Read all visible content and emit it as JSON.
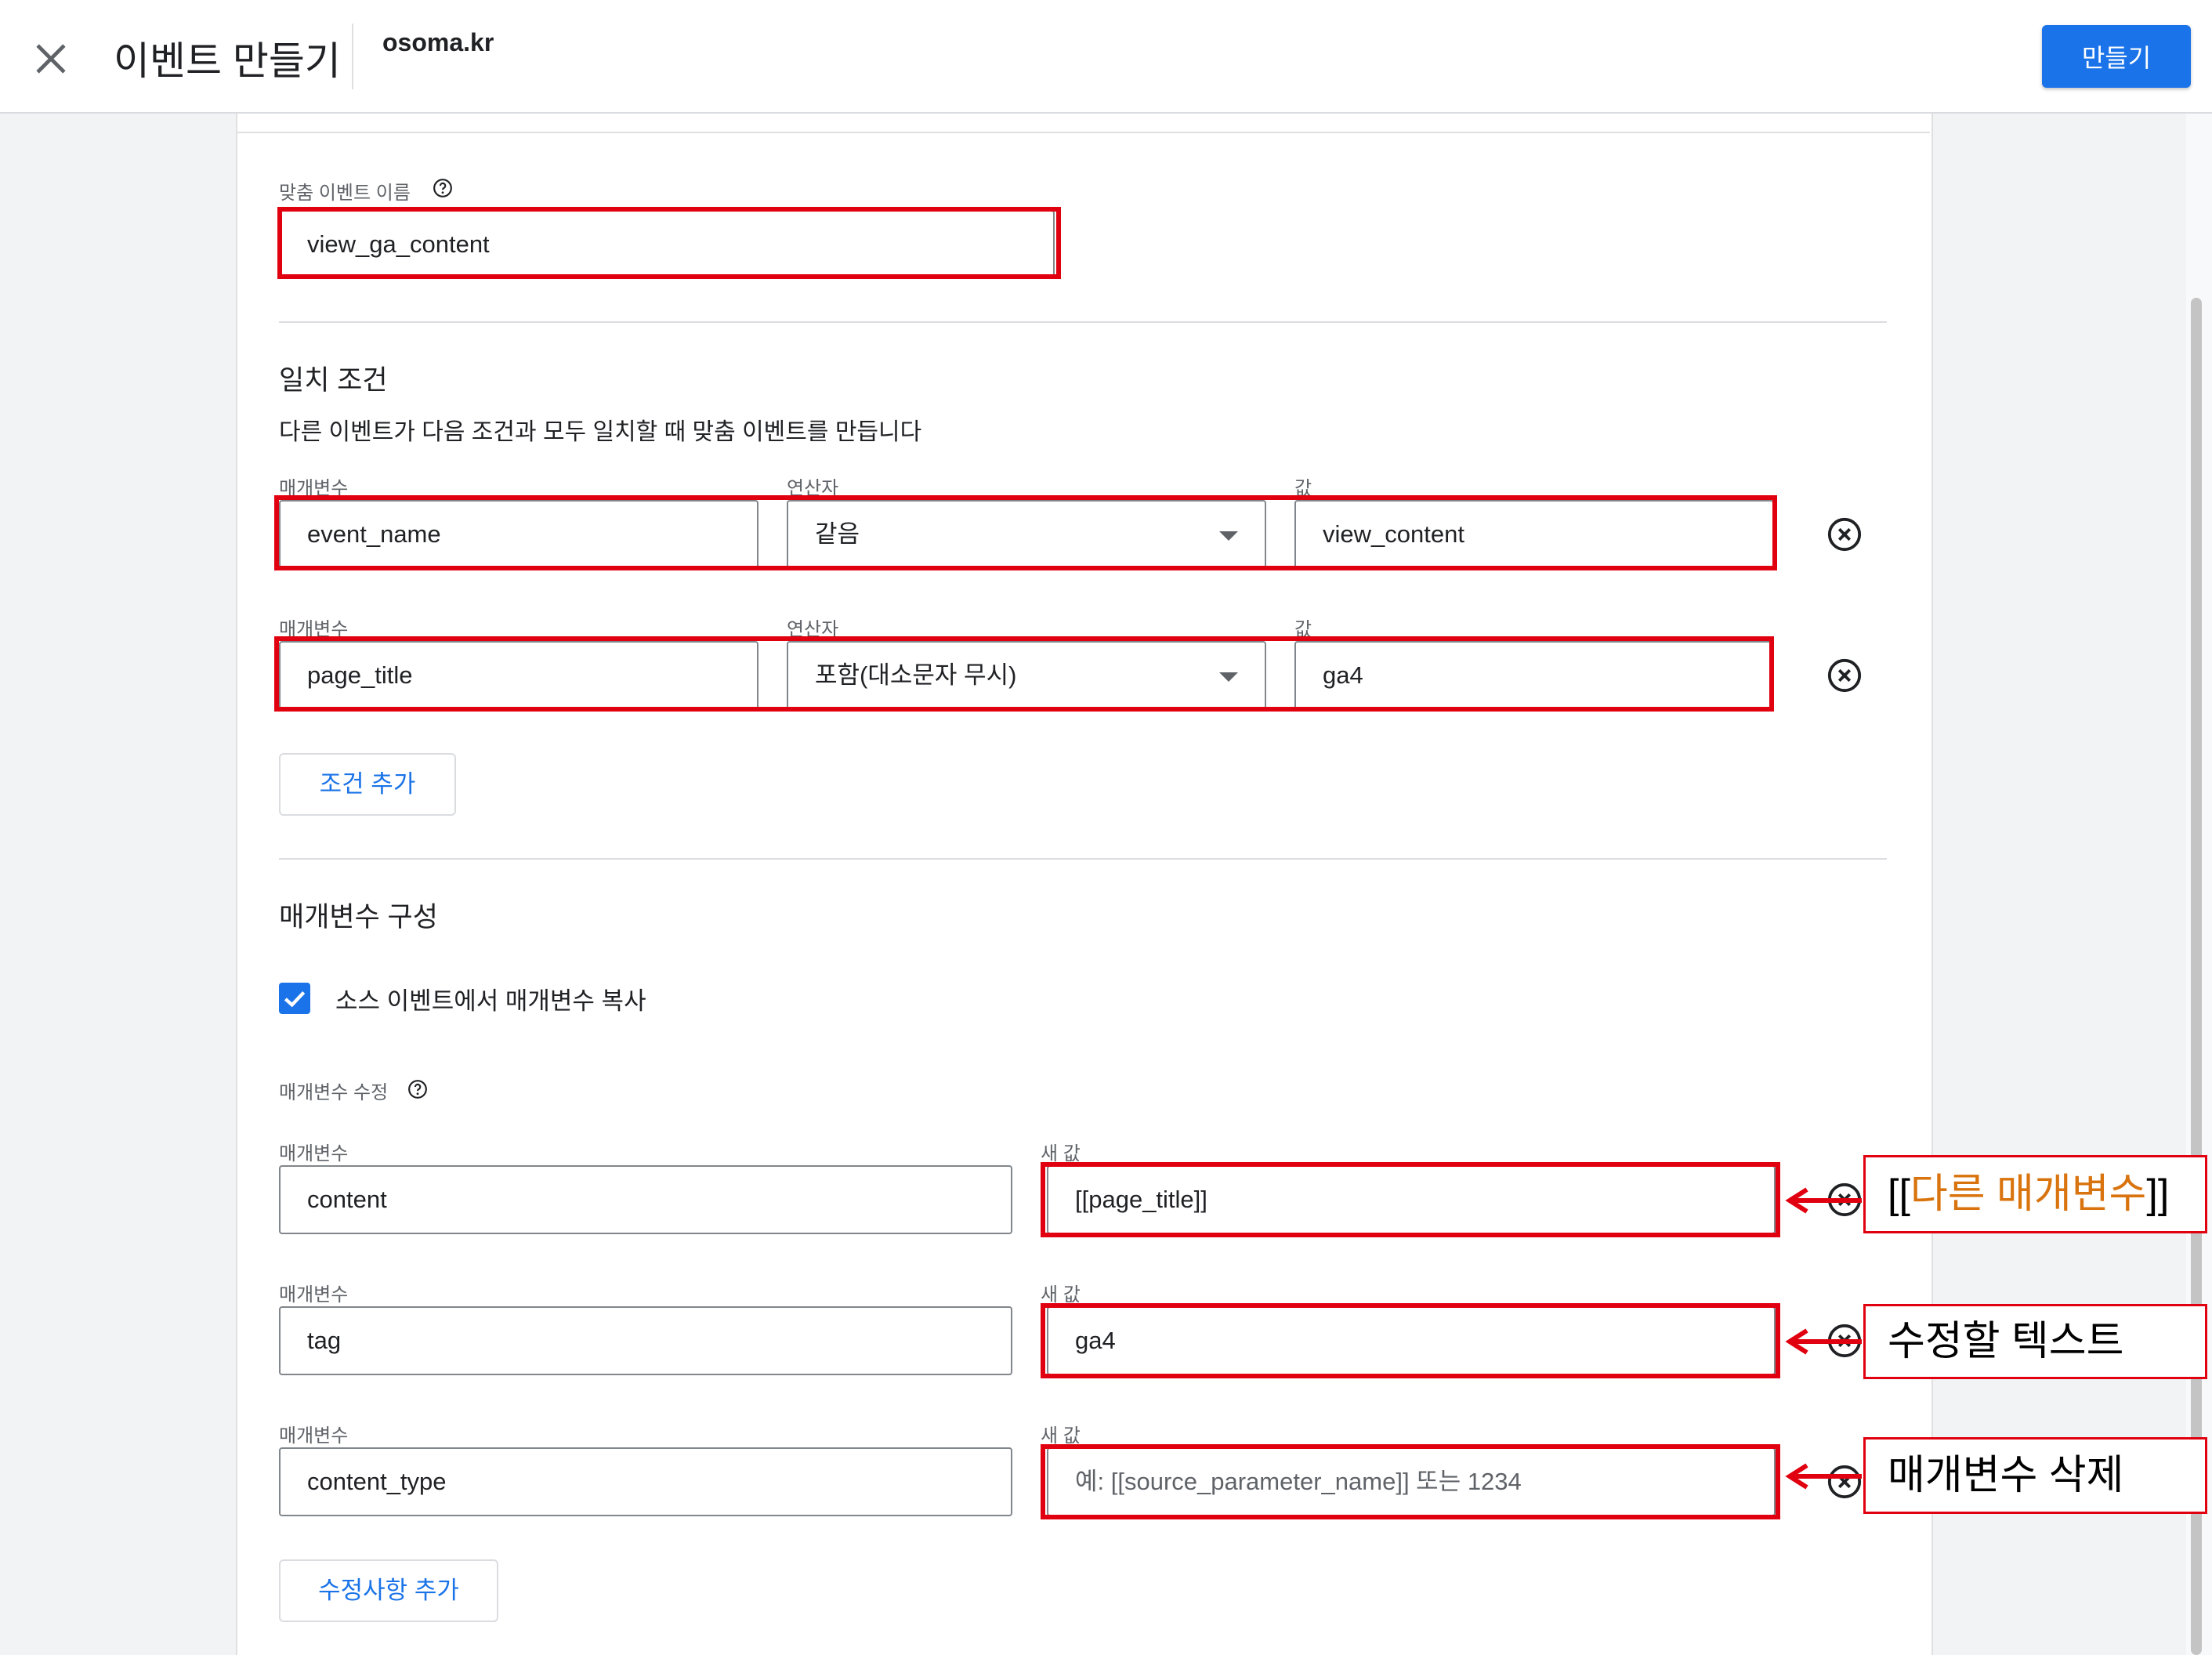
{
  "topbar": {
    "title": "이벤트 만들기",
    "account": "osoma.kr",
    "create_button": "만들기"
  },
  "custom_event": {
    "label": "맞춤 이벤트 이름",
    "value": "view_ga_content"
  },
  "matching": {
    "title": "일치 조건",
    "description": "다른 이벤트가 다음 조건과 모두 일치할 때 맞춤 이벤트를 만듭니다",
    "param_label": "매개변수",
    "operator_label": "연산자",
    "value_label": "값",
    "conditions": [
      {
        "parameter": "event_name",
        "operator": "같음",
        "value": "view_content"
      },
      {
        "parameter": "page_title",
        "operator": "포함(대소문자 무시)",
        "value": "ga4"
      }
    ],
    "add_condition_button": "조건 추가"
  },
  "param_config": {
    "title": "매개변수 구성",
    "copy_checkbox_label": "소스 이벤트에서 매개변수 복사",
    "copy_checked": true,
    "modify_label": "매개변수 수정",
    "param_label": "매개변수",
    "new_value_label": "새 값",
    "rows": [
      {
        "parameter": "content",
        "new_value": "[[page_title]]",
        "placeholder": ""
      },
      {
        "parameter": "tag",
        "new_value": "ga4",
        "placeholder": ""
      },
      {
        "parameter": "content_type",
        "new_value": "",
        "placeholder": "예: [[source_parameter_name]] 또는 1234"
      }
    ],
    "add_modification_button": "수정사항 추가"
  },
  "annotations": [
    {
      "prefix": "[[",
      "highlight": "다른 매개변수",
      "suffix": "]]"
    },
    {
      "text": "수정할 텍스트"
    },
    {
      "text": "매개변수 삭제"
    }
  ],
  "colors": {
    "accent": "#1a73e8",
    "annotation_red": "#e1000f",
    "annotation_orange": "#d9730d"
  }
}
